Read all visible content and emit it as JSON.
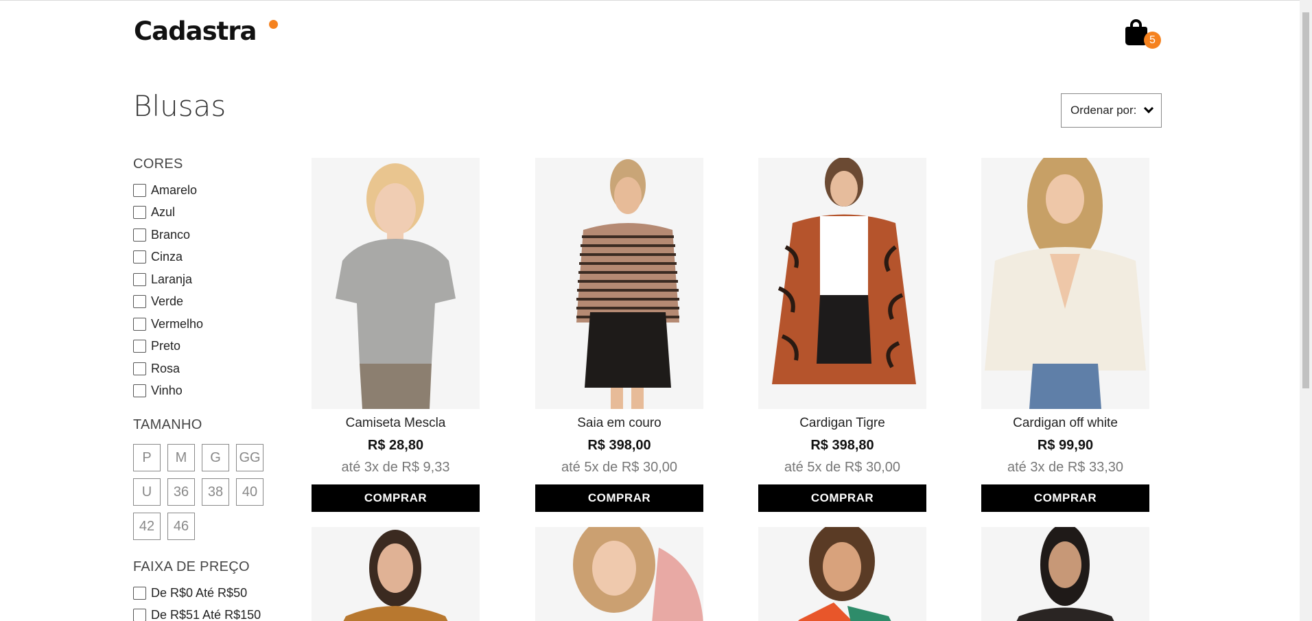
{
  "header": {
    "logo_text": "Cadastra",
    "cart_count": "5",
    "cart_icon": "shopping-bag-icon",
    "accent_color": "#f5821f"
  },
  "page": {
    "title": "Blusas",
    "sort_label": "Ordenar por:"
  },
  "filters": {
    "colors": {
      "title": "CORES",
      "items": [
        "Amarelo",
        "Azul",
        "Branco",
        "Cinza",
        "Laranja",
        "Verde",
        "Vermelho",
        "Preto",
        "Rosa",
        "Vinho"
      ]
    },
    "sizes": {
      "title": "TAMANHO",
      "items": [
        "P",
        "M",
        "G",
        "GG",
        "U",
        "36",
        "38",
        "40",
        "42",
        "46"
      ]
    },
    "price": {
      "title": "FAIXA DE PREÇO",
      "items": [
        "De R$0 Até R$50",
        "De R$51 Até R$150"
      ]
    }
  },
  "products": [
    {
      "name": "Camiseta Mescla",
      "price": "R$ 28,80",
      "installments": "até 3x de R$ 9,33",
      "button": "COMPRAR"
    },
    {
      "name": "Saia em couro",
      "price": "R$ 398,00",
      "installments": "até 5x de R$ 30,00",
      "button": "COMPRAR"
    },
    {
      "name": "Cardigan Tigre",
      "price": "R$ 398,80",
      "installments": "até 5x de R$ 30,00",
      "button": "COMPRAR"
    },
    {
      "name": "Cardigan off white",
      "price": "R$ 99,90",
      "installments": "até 3x de R$ 33,30",
      "button": "COMPRAR"
    }
  ]
}
